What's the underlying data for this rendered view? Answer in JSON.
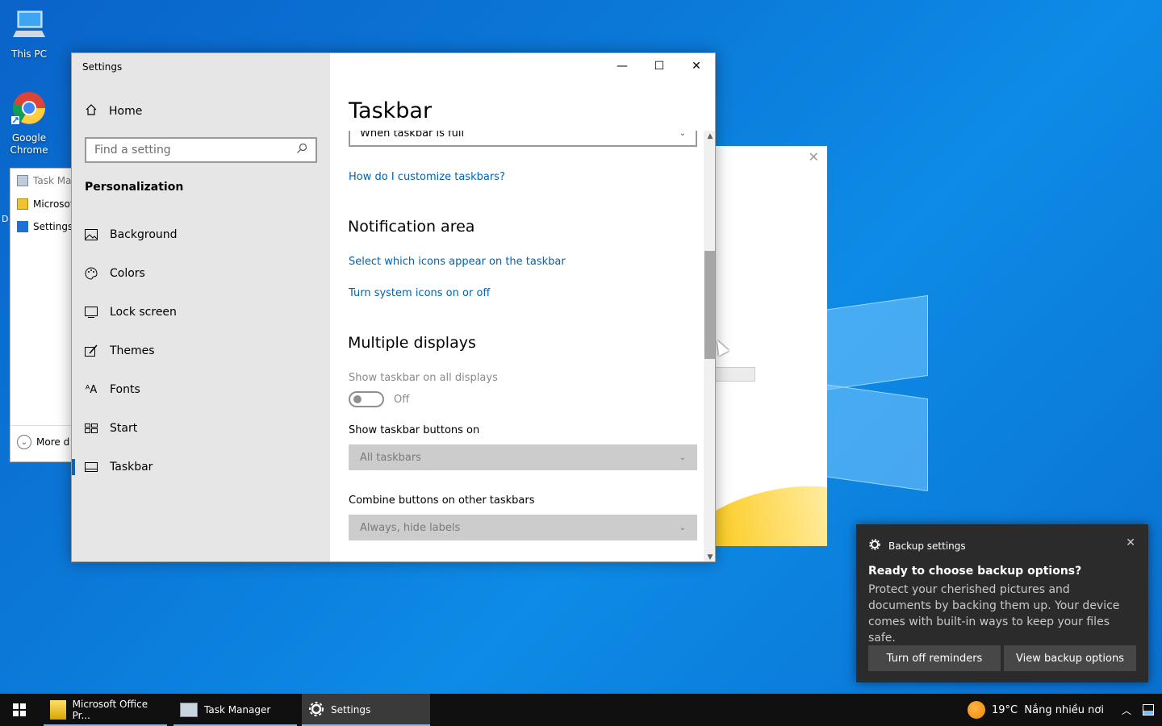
{
  "desktop": {
    "icons": [
      {
        "label": "This PC"
      },
      {
        "label": "Google Chrome"
      }
    ],
    "partial_label": "D"
  },
  "task_manager_bg": {
    "items": [
      "Task Man",
      "Microsof",
      "Settings"
    ],
    "more_label": "More d"
  },
  "settings": {
    "window_title": "Settings",
    "caption": {
      "minimize": "—",
      "maximize": "☐",
      "close": "✕"
    },
    "nav": {
      "home": "Home",
      "search_placeholder": "Find a setting",
      "section": "Personalization",
      "items": [
        {
          "label": "Background",
          "icon": "picture-icon"
        },
        {
          "label": "Colors",
          "icon": "palette-icon"
        },
        {
          "label": "Lock screen",
          "icon": "monitor-icon"
        },
        {
          "label": "Themes",
          "icon": "brush-icon"
        },
        {
          "label": "Fonts",
          "icon": "font-icon"
        },
        {
          "label": "Start",
          "icon": "start-grid-icon"
        },
        {
          "label": "Taskbar",
          "icon": "taskbar-icon",
          "active": true
        }
      ]
    },
    "page": {
      "title": "Taskbar",
      "combine_dropdown_value": "When taskbar is full",
      "customize_link": "How do I customize taskbars?",
      "notification_heading": "Notification area",
      "select_icons_link": "Select which icons appear on the taskbar",
      "system_icons_link": "Turn system icons on or off",
      "multi_heading": "Multiple displays",
      "show_all_label": "Show taskbar on all displays",
      "toggle_state": "Off",
      "buttons_on_label": "Show taskbar buttons on",
      "buttons_on_value": "All taskbars",
      "combine_other_label": "Combine buttons on other taskbars",
      "combine_other_value": "Always, hide labels"
    }
  },
  "toast": {
    "app": "Backup settings",
    "title": "Ready to choose backup options?",
    "body": "Protect your cherished pictures and documents by backing them up. Your device comes with built-in ways to keep your files safe.",
    "btn_off": "Turn off reminders",
    "btn_view": "View backup options"
  },
  "taskbar": {
    "apps": [
      {
        "label": "Microsoft Office Pr..."
      },
      {
        "label": "Task Manager"
      },
      {
        "label": "Settings"
      }
    ],
    "weather": "19°C  Nắng nhiều nơi"
  }
}
